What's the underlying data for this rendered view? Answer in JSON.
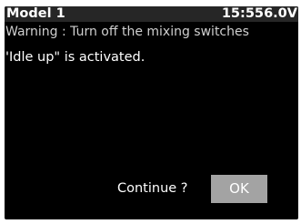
{
  "header": {
    "model": "Model 1",
    "time": "15:55",
    "voltage": "6.0V"
  },
  "warning": "Warning : Turn off the mixing switches",
  "message": "'Idle up\" is activated.",
  "dialog": {
    "prompt": "Continue ?",
    "ok_label": "OK"
  },
  "colors": {
    "screen_bg": "#000000",
    "header_bg": "#262626",
    "button_bg": "#a3a3a3",
    "text": "#ffffff"
  }
}
